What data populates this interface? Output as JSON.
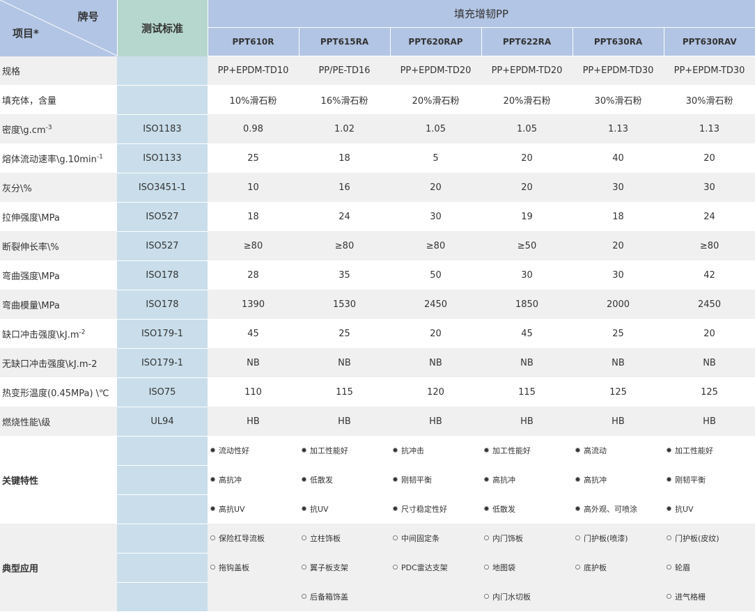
{
  "header": {
    "brand_label": "牌号",
    "item_label": "项目*",
    "std_label": "测试标准",
    "group_label": "填充增韧PP",
    "grades": [
      "PPT610R",
      "PPT615RA",
      "PPT620RAP",
      "PPT622RA",
      "PPT630RA",
      "PPT630RAV"
    ]
  },
  "rows": [
    {
      "label": "规格",
      "sup": "",
      "std": "",
      "values": [
        "PP+EPDM-TD10",
        "PP/PE-TD16",
        "PP+EPDM-TD20",
        "PP+EPDM-TD20",
        "PP+EPDM-TD30",
        "PP+EPDM-TD30"
      ]
    },
    {
      "label": "填充体，含量",
      "sup": "",
      "std": "",
      "values": [
        "10%滑石粉",
        "16%滑石粉",
        "20%滑石粉",
        "20%滑石粉",
        "30%滑石粉",
        "30%滑石粉"
      ]
    },
    {
      "label": "密度\\g.cm",
      "sup": "-3",
      "std": "ISO1183",
      "values": [
        "0.98",
        "1.02",
        "1.05",
        "1.05",
        "1.13",
        "1.13"
      ]
    },
    {
      "label": "熔体流动速率\\g.10min",
      "sup": "-1",
      "std": "ISO1133",
      "values": [
        "25",
        "18",
        "5",
        "20",
        "40",
        "20"
      ]
    },
    {
      "label": "灰分\\%",
      "sup": "",
      "std": "ISO3451-1",
      "values": [
        "10",
        "16",
        "20",
        "20",
        "30",
        "30"
      ]
    },
    {
      "label": "拉伸强度\\MPa",
      "sup": "",
      "std": "ISO527",
      "values": [
        "18",
        "24",
        "30",
        "19",
        "18",
        "24"
      ]
    },
    {
      "label": "断裂伸长率\\%",
      "sup": "",
      "std": "ISO527",
      "values": [
        "≥80",
        "≥80",
        "≥80",
        "≥50",
        "20",
        "≥80"
      ]
    },
    {
      "label": "弯曲强度\\MPa",
      "sup": "",
      "std": "ISO178",
      "values": [
        "28",
        "35",
        "50",
        "30",
        "30",
        "42"
      ]
    },
    {
      "label": "弯曲模量\\MPa",
      "sup": "",
      "std": "ISO178",
      "values": [
        "1390",
        "1530",
        "2450",
        "1850",
        "2000",
        "2450"
      ]
    },
    {
      "label": "缺口冲击强度\\kJ.m",
      "sup": "-2",
      "std": "ISO179-1",
      "values": [
        "45",
        "25",
        "20",
        "45",
        "25",
        "20"
      ]
    },
    {
      "label": "无缺口冲击强度\\kJ.m-2",
      "sup": "",
      "std": "ISO179-1",
      "values": [
        "NB",
        "NB",
        "NB",
        "NB",
        "NB",
        "NB"
      ]
    },
    {
      "label": "热变形温度(0.45MPa) \\℃",
      "sup": "",
      "std": "ISO75",
      "values": [
        "110",
        "115",
        "120",
        "115",
        "125",
        "125"
      ]
    },
    {
      "label": "燃烧性能\\级",
      "sup": "",
      "std": "UL94",
      "values": [
        "HB",
        "HB",
        "HB",
        "HB",
        "HB",
        "HB"
      ]
    }
  ],
  "features": {
    "label": "关键特性",
    "rows": [
      [
        "流动性好",
        "加工性能好",
        "抗冲击",
        "加工性能好",
        "高流动",
        "加工性能好"
      ],
      [
        "高抗冲",
        "低散发",
        "刚韧平衡",
        "高抗冲",
        "高抗冲",
        "刚韧平衡"
      ],
      [
        "高抗UV",
        "抗UV",
        "尺寸稳定性好",
        "低散发",
        "高外观、可喷涂",
        "抗UV"
      ]
    ]
  },
  "applications": {
    "label": "典型应用",
    "rows": [
      [
        "保险杠导流板",
        "立柱饰板",
        "中间固定条",
        "内门饰板",
        "门护板(喷漆)",
        "门护板(皮纹)"
      ],
      [
        "拖钩盖板",
        "翼子板支架",
        "PDC雷达支架",
        "地图袋",
        "底护板",
        "轮眉"
      ],
      [
        "",
        "后备箱饰盖",
        "",
        "内门水切板",
        "",
        "进气格栅"
      ]
    ]
  }
}
